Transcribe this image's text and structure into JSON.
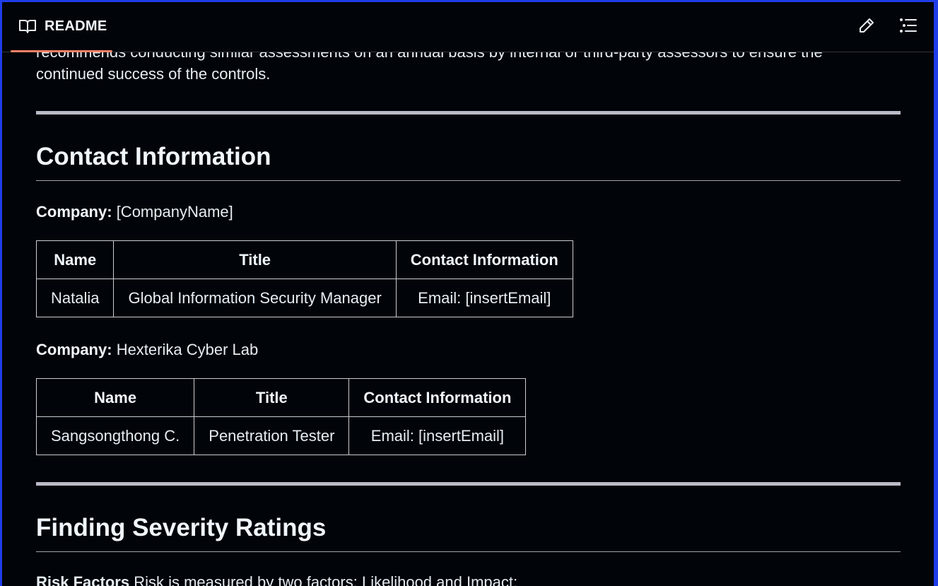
{
  "header": {
    "tab_label": "README",
    "edit_icon": "pencil-icon",
    "toc_icon": "list-icon",
    "accent_color": "#f78166"
  },
  "intro": {
    "cut_line": "recommends conducting similar assessments on an annual basis by internal or third-party assessors to ensure the",
    "last_line": "continued success of the controls."
  },
  "contact_section": {
    "heading": "Contact Information",
    "companies": [
      {
        "label": "Company:",
        "name": "[CompanyName]",
        "headers": [
          "Name",
          "Title",
          "Contact Information"
        ],
        "rows": [
          [
            "Natalia",
            "Global Information Security Manager",
            "Email: [insertEmail]"
          ]
        ]
      },
      {
        "label": "Company:",
        "name": "Hexterika Cyber Lab",
        "headers": [
          "Name",
          "Title",
          "Contact Information"
        ],
        "rows": [
          [
            "Sangsongthong C.",
            "Penetration Tester",
            "Email: [insertEmail]"
          ]
        ]
      }
    ]
  },
  "severity_section": {
    "heading": "Finding Severity Ratings",
    "risk_label": "Risk Factors",
    "risk_text": "Risk is measured by two factors: Likelihood and Impact:"
  }
}
